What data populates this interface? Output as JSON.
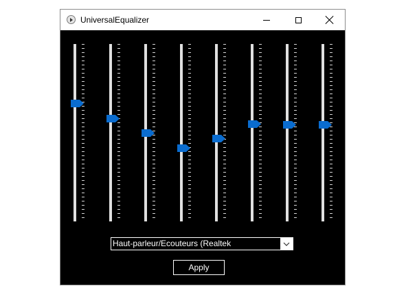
{
  "window": {
    "title": "UniversalEqualizer",
    "controls": [
      "minimize",
      "maximize",
      "close"
    ]
  },
  "equalizer": {
    "band_count": 8,
    "levels": [
      0.335,
      0.42,
      0.5,
      0.585,
      0.53,
      0.45,
      0.455,
      0.455
    ],
    "thumb_color": "#0a6ccf"
  },
  "device": {
    "selected": "Haut-parleur/Ecouteurs (Realtek"
  },
  "apply_label": "Apply",
  "icons": {
    "app": "app-icon",
    "minimize": "minimize-icon",
    "maximize": "maximize-icon",
    "close": "close-icon",
    "dropdown": "chevron-down-icon"
  }
}
